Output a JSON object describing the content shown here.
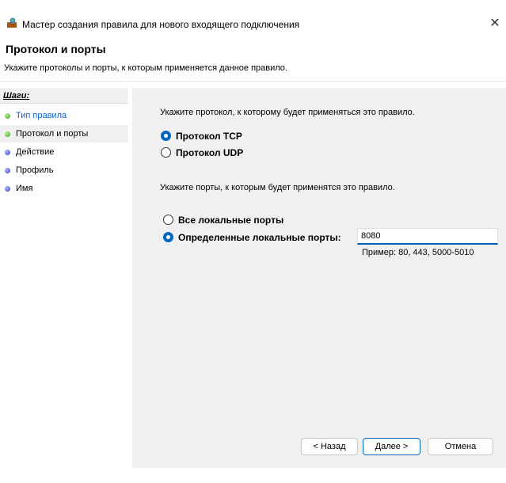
{
  "window": {
    "title": "Мастер создания правила для нового входящего подключения",
    "icon": "firewall-wizard-icon",
    "close_glyph": "✕"
  },
  "header": {
    "title": "Протокол и порты",
    "subtitle": "Укажите протоколы и порты, к которым применяется данное правило."
  },
  "sidebar": {
    "heading": "Шаги:",
    "steps": [
      {
        "label": "Тип правила",
        "state": "done"
      },
      {
        "label": "Протокол и порты",
        "state": "current"
      },
      {
        "label": "Действие",
        "state": "pending"
      },
      {
        "label": "Профиль",
        "state": "pending"
      },
      {
        "label": "Имя",
        "state": "pending"
      }
    ]
  },
  "main": {
    "protocol_instruction": "Укажите протокол, к которому будет применяться это правило.",
    "protocol_options": [
      {
        "label": "Протокол TCP",
        "selected": true
      },
      {
        "label": "Протокол UDP",
        "selected": false
      }
    ],
    "ports_instruction": "Укажите порты, к которым будет применятся это правило.",
    "port_options": [
      {
        "label": "Все локальные порты",
        "selected": false
      },
      {
        "label": "Определенные локальные порты:",
        "selected": true
      }
    ],
    "port_value": "8080",
    "port_example": "Пример: 80, 443, 5000-5010"
  },
  "buttons": {
    "back": "< Назад",
    "next": "Далее >",
    "cancel": "Отмена"
  },
  "colors": {
    "accent": "#0067c0",
    "panel_bg": "#f0f0f0"
  }
}
